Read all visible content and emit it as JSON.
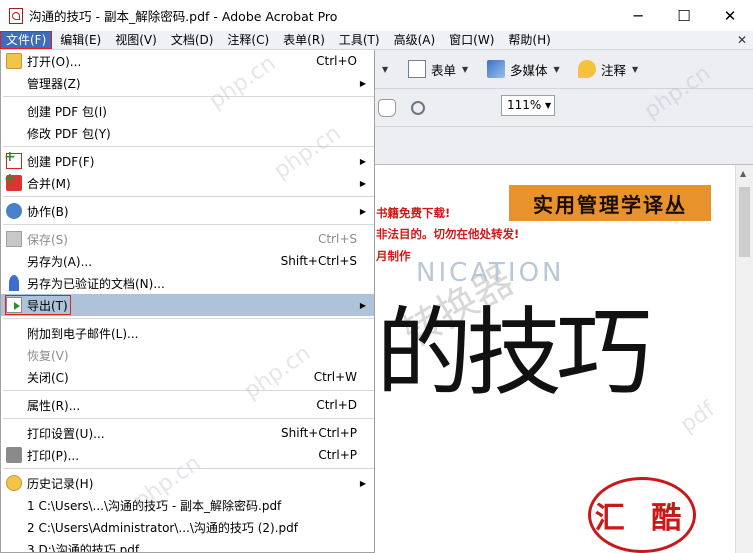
{
  "window": {
    "title": "沟通的技巧 - 副本_解除密码.pdf - Adobe Acrobat Pro",
    "controls": {
      "minimize": "─",
      "maximize": "☐",
      "close": "✕"
    }
  },
  "menubar": {
    "items": [
      {
        "label": "文件(F)",
        "active": true
      },
      {
        "label": "编辑(E)"
      },
      {
        "label": "视图(V)"
      },
      {
        "label": "文档(D)"
      },
      {
        "label": "注释(C)"
      },
      {
        "label": "表单(R)"
      },
      {
        "label": "工具(T)"
      },
      {
        "label": "高级(A)"
      },
      {
        "label": "窗口(W)"
      },
      {
        "label": "帮助(H)"
      }
    ],
    "close_doc": "✕"
  },
  "toolbar": {
    "forms_label": "表单",
    "multimedia_label": "多媒体",
    "comments_label": "注释",
    "zoom_value": "111%",
    "zoom_out": "−",
    "zoom_in": "+"
  },
  "file_menu": {
    "items": [
      {
        "label": "打开(O)...",
        "shortcut": "Ctrl+O",
        "icon": "open-folder-icon"
      },
      {
        "label": "管理器(Z)",
        "submenu": true
      },
      {
        "sep": true
      },
      {
        "label": "创建 PDF 包(I)"
      },
      {
        "label": "修改 PDF 包(Y)"
      },
      {
        "sep": true
      },
      {
        "label": "创建 PDF(F)",
        "submenu": true,
        "icon": "create-pdf-icon"
      },
      {
        "label": "合并(M)",
        "submenu": true,
        "icon": "merge-icon"
      },
      {
        "sep": true
      },
      {
        "label": "协作(B)",
        "submenu": true,
        "icon": "collaborate-icon"
      },
      {
        "sep": true
      },
      {
        "label": "保存(S)",
        "shortcut": "Ctrl+S",
        "disabled": true,
        "icon": "save-icon"
      },
      {
        "label": "另存为(A)...",
        "shortcut": "Shift+Ctrl+S"
      },
      {
        "label": "另存为已验证的文档(N)...",
        "icon": "certified-ribbon-icon"
      },
      {
        "label": "导出(T)",
        "submenu": true,
        "highlight": true,
        "icon": "export-icon"
      },
      {
        "sep": true
      },
      {
        "label": "附加到电子邮件(L)..."
      },
      {
        "label": "恢复(V)",
        "disabled": true
      },
      {
        "label": "关闭(C)",
        "shortcut": "Ctrl+W"
      },
      {
        "sep": true
      },
      {
        "label": "属性(R)...",
        "shortcut": "Ctrl+D"
      },
      {
        "sep": true
      },
      {
        "label": "打印设置(U)...",
        "shortcut": "Shift+Ctrl+P"
      },
      {
        "label": "打印(P)...",
        "shortcut": "Ctrl+P",
        "icon": "printer-icon"
      },
      {
        "sep": true
      },
      {
        "label": "历史记录(H)",
        "submenu": true,
        "icon": "history-icon"
      },
      {
        "label": "1 C:\\Users\\...\\沟通的技巧 - 副本_解除密码.pdf"
      },
      {
        "label": "2 C:\\Users\\Administrator\\...\\沟通的技巧 (2).pdf"
      },
      {
        "label": "3 D:\\沟通的技巧.pdf"
      }
    ],
    "submenu_arrow": "▶"
  },
  "document": {
    "banner": "实用管理学译丛",
    "red_line_1": "书籍免费下载!",
    "red_line_2": "非法目的。切勿在他处转发!",
    "red_line_3": "月制作",
    "ghost_text": "NICATION",
    "ghost_cn": "转换器",
    "big_title": "的技巧",
    "seal_text": "汇 酷"
  },
  "watermarks": [
    "php.cn",
    "php.cn",
    "php.cn",
    "php.cn",
    "php.cn",
    "pdf"
  ]
}
